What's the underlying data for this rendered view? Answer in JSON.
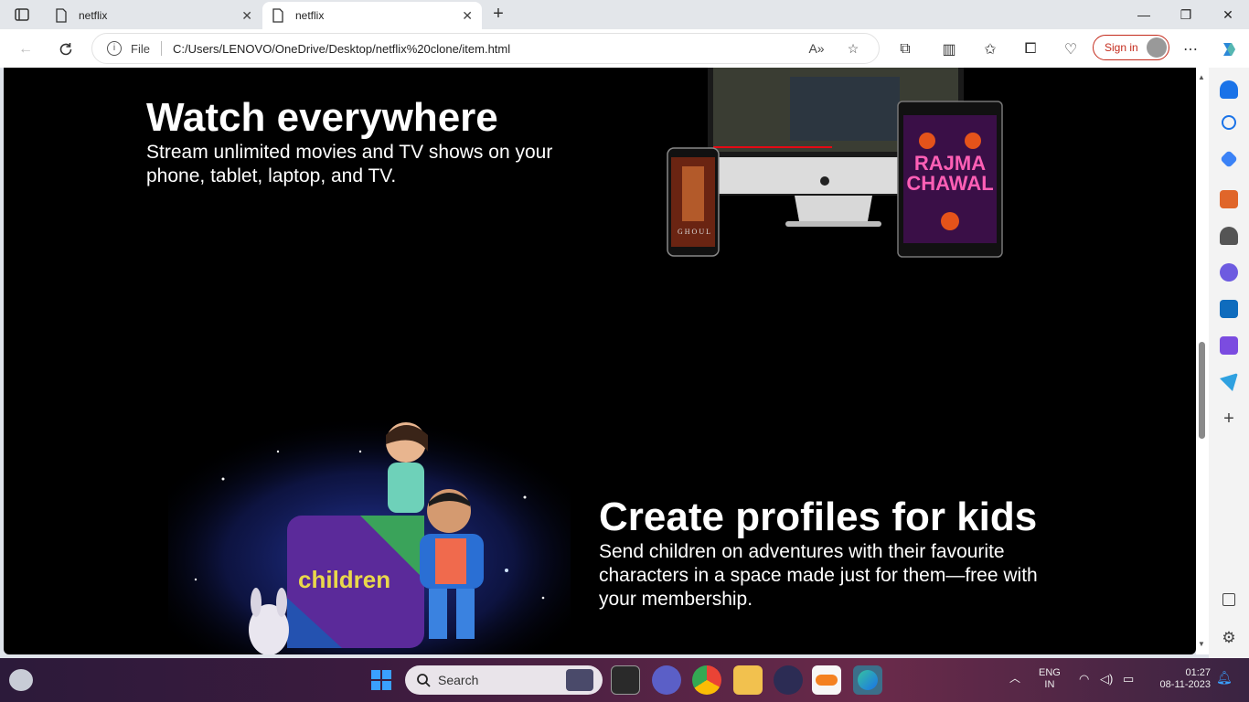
{
  "browser": {
    "tabs": [
      {
        "title": "netflix",
        "active": false
      },
      {
        "title": "netflix",
        "active": true
      }
    ],
    "new_tab": "+",
    "address": {
      "scheme_label": "File",
      "url": "C:/Users/LENOVO/OneDrive/Desktop/netflix%20clone/item.html"
    },
    "sign_in": "Sign in"
  },
  "page": {
    "section1": {
      "title": "Watch everywhere",
      "body": "Stream unlimited movies and TV shows on your phone, tablet, laptop, and TV.",
      "phone_poster": "GHOUL",
      "tablet_poster_line1": "RAJMA",
      "tablet_poster_line2": "CHAWAL"
    },
    "section2": {
      "title": "Create profiles for kids",
      "body": "Send children on adventures with their favourite characters in a space made just for them—free with your membership.",
      "box_label": "children"
    }
  },
  "taskbar": {
    "search_placeholder": "Search",
    "lang_line1": "ENG",
    "lang_line2": "IN",
    "time": "01:27",
    "date": "08-11-2023"
  },
  "colors": {
    "accent": "#c42b1c",
    "page_bg": "#000000",
    "kids_box_yellow": "#e9d84a"
  }
}
